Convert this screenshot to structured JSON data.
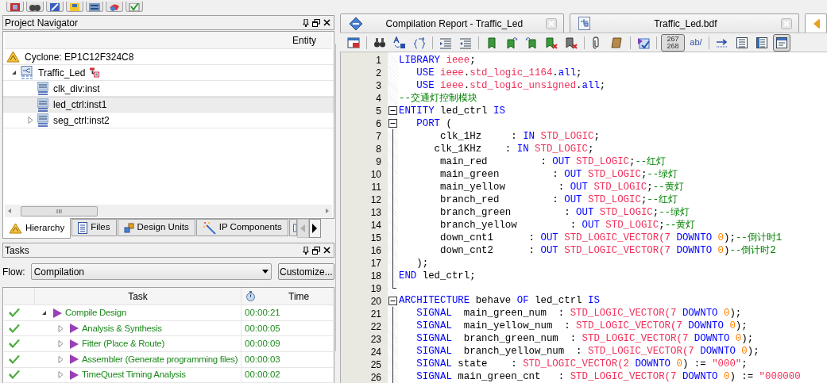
{
  "project_navigator": {
    "title": "Project Navigator",
    "column": "Entity",
    "tree": [
      {
        "kind": "device",
        "label": "Cyclone: EP1C12F324C8",
        "selected": false
      },
      {
        "kind": "bdf",
        "label": "Traffic_Led",
        "expanded": true,
        "selected": false,
        "children": [
          {
            "kind": "vhd",
            "label": "clk_div:inst",
            "selected": false
          },
          {
            "kind": "vhd",
            "label": "led_ctrl:inst1",
            "selected": true
          },
          {
            "kind": "vhd",
            "label": "seg_ctrl:inst2",
            "expanded": false,
            "selected": false
          }
        ]
      }
    ],
    "tabs": [
      {
        "kind": "hierarchy",
        "label": "Hierarchy",
        "selected": true
      },
      {
        "kind": "files",
        "label": "Files",
        "selected": false
      },
      {
        "kind": "units",
        "label": "Design Units",
        "selected": false
      },
      {
        "kind": "ip",
        "label": "IP Components",
        "selected": false
      },
      {
        "kind": "cut",
        "selected": false
      }
    ]
  },
  "tasks": {
    "title": "Tasks",
    "flow_label": "Flow:",
    "flow_value": "Compilation",
    "customize": "Customize...",
    "columns": [
      "Task",
      "Time"
    ],
    "rows": [
      {
        "task": "Compile Design",
        "time": "00:00:21",
        "done": true,
        "expanded": true,
        "children": [
          {
            "task": "Analysis & Synthesis",
            "time": "00:00:05",
            "done": true,
            "expanded": false
          },
          {
            "task": "Fitter (Place & Route)",
            "time": "00:00:09",
            "done": true,
            "expanded": false
          },
          {
            "task": "Assembler (Generate programming files)",
            "time": "00:00:03",
            "done": true,
            "expanded": false
          },
          {
            "task": "TimeQuest Timing Analysis",
            "time": "00:00:02",
            "done": true,
            "expanded": false
          }
        ]
      }
    ]
  },
  "documents": [
    {
      "kind": "report",
      "title": "Compilation Report - Traffic_Led",
      "selected": false
    },
    {
      "kind": "bdf",
      "title": "Traffic_Led.bdf",
      "selected": false
    },
    {
      "kind": "cut",
      "selected": true
    }
  ],
  "editor_toolbar": [
    {
      "pressed": false
    },
    {
      "pressed": false
    },
    {
      "pressed": false
    },
    {
      "pressed": false
    },
    {
      "pressed": false
    },
    {
      "pressed": false
    },
    {
      "pressed": false
    },
    {
      "pressed": false
    },
    {
      "pressed": false
    },
    {
      "pressed": false
    },
    {
      "pressed": false
    },
    {
      "pressed": false
    },
    {
      "pressed": false
    },
    {
      "pressed": false
    },
    {
      "pressed": true,
      "text": [
        "267",
        "268"
      ]
    },
    {
      "pressed": false,
      "text": [
        "ab/"
      ]
    },
    {
      "pressed": false
    },
    {
      "pressed": false
    },
    {
      "pressed": false
    },
    {
      "pressed": true
    }
  ],
  "code": [
    {
      "number": "1",
      "tokens": [
        {
          "kind": "keyword",
          "text": "LIBRARY"
        },
        {
          "kind": "name",
          "text": " ieee"
        },
        {
          "kind": "plain",
          "text": ";"
        }
      ]
    },
    {
      "number": "2",
      "tokens": [
        {
          "kind": "keyword",
          "text": "   USE"
        },
        {
          "kind": "name",
          "text": " ieee"
        },
        {
          "kind": "plain",
          "text": "."
        },
        {
          "kind": "name",
          "text": "std_logic_1164"
        },
        {
          "kind": "plain",
          "text": "."
        },
        {
          "kind": "keyword",
          "text": "all"
        },
        {
          "kind": "plain",
          "text": ";"
        }
      ]
    },
    {
      "number": "3",
      "tokens": [
        {
          "kind": "keyword",
          "text": "   USE"
        },
        {
          "kind": "name",
          "text": " ieee"
        },
        {
          "kind": "plain",
          "text": "."
        },
        {
          "kind": "name",
          "text": "std_logic_unsigned"
        },
        {
          "kind": "plain",
          "text": "."
        },
        {
          "kind": "keyword",
          "text": "all"
        },
        {
          "kind": "plain",
          "text": ";"
        }
      ]
    },
    {
      "number": "4",
      "tokens": [
        {
          "kind": "comment",
          "text": "--交通灯控制模块"
        }
      ]
    },
    {
      "number": "5",
      "expanded": true,
      "tokens": [
        {
          "kind": "keyword",
          "text": "ENTITY"
        },
        {
          "kind": "plain",
          "text": " led_ctrl "
        },
        {
          "kind": "keyword",
          "text": "IS"
        }
      ]
    },
    {
      "number": "6",
      "expanded": true,
      "tokens": [
        {
          "kind": "keyword",
          "text": "   PORT"
        },
        {
          "kind": "plain",
          "text": " ("
        }
      ]
    },
    {
      "number": "7",
      "tokens": [
        {
          "kind": "plain",
          "text": "       clk_1Hz     : "
        },
        {
          "kind": "keyword",
          "text": "IN"
        },
        {
          "kind": "name",
          "text": " STD_LOGIC"
        },
        {
          "kind": "plain",
          "text": ";"
        }
      ]
    },
    {
      "number": "8",
      "tokens": [
        {
          "kind": "plain",
          "text": "      clk_1KHz    : "
        },
        {
          "kind": "keyword",
          "text": "IN"
        },
        {
          "kind": "name",
          "text": " STD_LOGIC"
        },
        {
          "kind": "plain",
          "text": ";"
        }
      ]
    },
    {
      "number": "9",
      "tokens": [
        {
          "kind": "plain",
          "text": "       main_red         : "
        },
        {
          "kind": "keyword",
          "text": "OUT"
        },
        {
          "kind": "name",
          "text": " STD_LOGIC"
        },
        {
          "kind": "plain",
          "text": ";"
        },
        {
          "kind": "comment",
          "text": "--红灯"
        }
      ]
    },
    {
      "number": "10",
      "tokens": [
        {
          "kind": "plain",
          "text": "       main_green         : "
        },
        {
          "kind": "keyword",
          "text": "OUT"
        },
        {
          "kind": "name",
          "text": " STD_LOGIC"
        },
        {
          "kind": "plain",
          "text": ";"
        },
        {
          "kind": "comment",
          "text": "--绿灯"
        }
      ]
    },
    {
      "number": "11",
      "tokens": [
        {
          "kind": "plain",
          "text": "       main_yellow         : "
        },
        {
          "kind": "keyword",
          "text": "OUT"
        },
        {
          "kind": "name",
          "text": " STD_LOGIC"
        },
        {
          "kind": "plain",
          "text": ";"
        },
        {
          "kind": "comment",
          "text": "--黄灯"
        }
      ]
    },
    {
      "number": "12",
      "tokens": [
        {
          "kind": "plain",
          "text": "       branch_red         : "
        },
        {
          "kind": "keyword",
          "text": "OUT"
        },
        {
          "kind": "name",
          "text": " STD_LOGIC"
        },
        {
          "kind": "plain",
          "text": ";"
        },
        {
          "kind": "comment",
          "text": "--红灯"
        }
      ]
    },
    {
      "number": "13",
      "tokens": [
        {
          "kind": "plain",
          "text": "       branch_green         : "
        },
        {
          "kind": "keyword",
          "text": "OUT"
        },
        {
          "kind": "name",
          "text": " STD_LOGIC"
        },
        {
          "kind": "plain",
          "text": ";"
        },
        {
          "kind": "comment",
          "text": "--绿灯"
        }
      ]
    },
    {
      "number": "14",
      "tokens": [
        {
          "kind": "plain",
          "text": "       branch_yellow         : "
        },
        {
          "kind": "keyword",
          "text": "OUT"
        },
        {
          "kind": "name",
          "text": " STD_LOGIC"
        },
        {
          "kind": "plain",
          "text": ";"
        },
        {
          "kind": "comment",
          "text": "--黄灯"
        }
      ]
    },
    {
      "number": "15",
      "tokens": [
        {
          "kind": "plain",
          "text": "       down_cnt1      : "
        },
        {
          "kind": "keyword",
          "text": "OUT"
        },
        {
          "kind": "name",
          "text": " STD_LOGIC_VECTOR(7"
        },
        {
          "kind": "keyword",
          "text": " DOWNTO"
        },
        {
          "kind": "number",
          "text": " 0"
        },
        {
          "kind": "plain",
          "text": ");"
        },
        {
          "kind": "comment",
          "text": "--倒计时1"
        }
      ]
    },
    {
      "number": "16",
      "tokens": [
        {
          "kind": "plain",
          "text": "       down_cnt2      : "
        },
        {
          "kind": "keyword",
          "text": "OUT"
        },
        {
          "kind": "name",
          "text": " STD_LOGIC_VECTOR(7"
        },
        {
          "kind": "keyword",
          "text": " DOWNTO"
        },
        {
          "kind": "number",
          "text": " 0"
        },
        {
          "kind": "plain",
          "text": ")"
        },
        {
          "kind": "comment",
          "text": "--倒计时2"
        }
      ]
    },
    {
      "number": "17",
      "tokens": [
        {
          "kind": "plain",
          "text": "   );"
        }
      ]
    },
    {
      "number": "18",
      "tokens": [
        {
          "kind": "keyword",
          "text": "END"
        },
        {
          "kind": "plain",
          "text": " led_ctrl;"
        }
      ]
    },
    {
      "number": "19"
    },
    {
      "number": "20",
      "expanded": true,
      "tokens": [
        {
          "kind": "keyword",
          "text": "ARCHITECTURE"
        },
        {
          "kind": "plain",
          "text": " behave "
        },
        {
          "kind": "keyword",
          "text": "OF"
        },
        {
          "kind": "plain",
          "text": " led_ctrl "
        },
        {
          "kind": "keyword",
          "text": "IS"
        }
      ]
    },
    {
      "number": "21",
      "tokens": [
        {
          "kind": "keyword",
          "text": "   SIGNAL"
        },
        {
          "kind": "plain",
          "text": "  main_green_num  : "
        },
        {
          "kind": "name",
          "text": "STD_LOGIC_VECTOR(7"
        },
        {
          "kind": "keyword",
          "text": " DOWNTO"
        },
        {
          "kind": "number",
          "text": " 0"
        },
        {
          "kind": "plain",
          "text": ");"
        }
      ]
    },
    {
      "number": "22",
      "tokens": [
        {
          "kind": "keyword",
          "text": "   SIGNAL"
        },
        {
          "kind": "plain",
          "text": "  main_yellow_num  : "
        },
        {
          "kind": "name",
          "text": "STD_LOGIC_VECTOR(7"
        },
        {
          "kind": "keyword",
          "text": " DOWNTO"
        },
        {
          "kind": "number",
          "text": " 0"
        },
        {
          "kind": "plain",
          "text": ");"
        }
      ]
    },
    {
      "number": "23",
      "tokens": [
        {
          "kind": "keyword",
          "text": "   SIGNAL"
        },
        {
          "kind": "plain",
          "text": "  branch_green_num  : "
        },
        {
          "kind": "name",
          "text": "STD_LOGIC_VECTOR(7"
        },
        {
          "kind": "keyword",
          "text": " DOWNTO"
        },
        {
          "kind": "number",
          "text": " 0"
        },
        {
          "kind": "plain",
          "text": ");"
        }
      ]
    },
    {
      "number": "24",
      "tokens": [
        {
          "kind": "keyword",
          "text": "   SIGNAL"
        },
        {
          "kind": "plain",
          "text": "  branch_yellow_num  : "
        },
        {
          "kind": "name",
          "text": "STD_LOGIC_VECTOR(7"
        },
        {
          "kind": "keyword",
          "text": " DOWNTO"
        },
        {
          "kind": "number",
          "text": " 0"
        },
        {
          "kind": "plain",
          "text": ");"
        }
      ]
    },
    {
      "number": "25",
      "tokens": [
        {
          "kind": "keyword",
          "text": "   SIGNAL"
        },
        {
          "kind": "plain",
          "text": " state    : "
        },
        {
          "kind": "name",
          "text": "STD_LOGIC_VECTOR(2"
        },
        {
          "kind": "keyword",
          "text": " DOWNTO"
        },
        {
          "kind": "number",
          "text": " 0"
        },
        {
          "kind": "plain",
          "text": ") := "
        },
        {
          "kind": "string",
          "text": "\"000\""
        },
        {
          "kind": "plain",
          "text": ";"
        }
      ]
    },
    {
      "number": "26",
      "tokens": [
        {
          "kind": "keyword",
          "text": "   SIGNAL"
        },
        {
          "kind": "plain",
          "text": " main_green_cnt   : "
        },
        {
          "kind": "name",
          "text": "STD_LOGIC_VECTOR(7"
        },
        {
          "kind": "keyword",
          "text": " DOWNTO"
        },
        {
          "kind": "number",
          "text": " 0"
        },
        {
          "kind": "plain",
          "text": ") := "
        },
        {
          "kind": "string",
          "text": "\"000000"
        }
      ]
    }
  ]
}
